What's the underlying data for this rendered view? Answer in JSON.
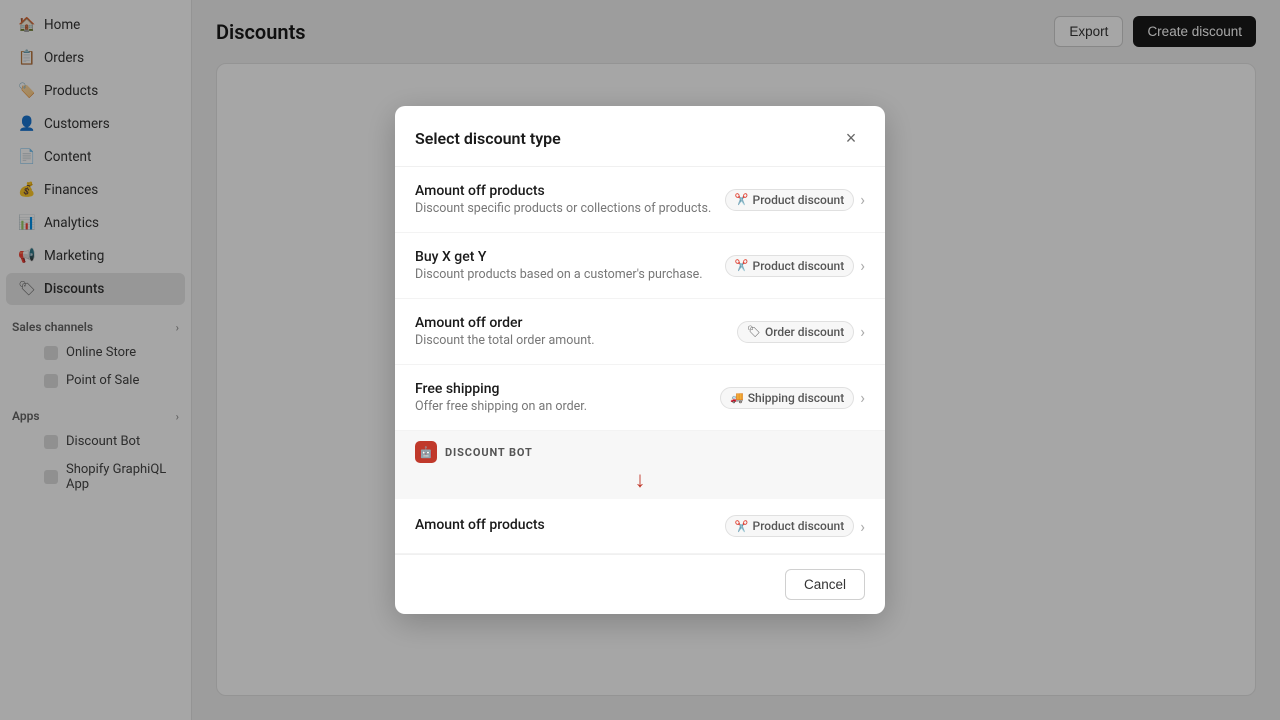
{
  "sidebar": {
    "items": [
      {
        "id": "home",
        "label": "Home",
        "icon": "🏠",
        "active": false
      },
      {
        "id": "orders",
        "label": "Orders",
        "icon": "📋",
        "active": false
      },
      {
        "id": "products",
        "label": "Products",
        "icon": "🏷️",
        "active": false
      },
      {
        "id": "customers",
        "label": "Customers",
        "icon": "👤",
        "active": false
      },
      {
        "id": "content",
        "label": "Content",
        "icon": "📄",
        "active": false
      },
      {
        "id": "finances",
        "label": "Finances",
        "icon": "💰",
        "active": false
      },
      {
        "id": "analytics",
        "label": "Analytics",
        "icon": "📊",
        "active": false
      },
      {
        "id": "marketing",
        "label": "Marketing",
        "icon": "📢",
        "active": false
      },
      {
        "id": "discounts",
        "label": "Discounts",
        "icon": "🏷",
        "active": true
      }
    ],
    "sales_channels_label": "Sales channels",
    "sales_channels": [
      {
        "id": "online-store",
        "label": "Online Store"
      },
      {
        "id": "point-of-sale",
        "label": "Point of Sale"
      }
    ],
    "apps_label": "Apps",
    "apps": [
      {
        "id": "discount-bot",
        "label": "Discount Bot"
      },
      {
        "id": "shopify-graphiql",
        "label": "Shopify GraphiQL App"
      }
    ]
  },
  "header": {
    "title": "Discounts",
    "export_label": "Export",
    "create_discount_label": "Create discount"
  },
  "modal": {
    "title": "Select discount type",
    "close_label": "×",
    "options": [
      {
        "id": "amount-off-products",
        "title": "Amount off products",
        "desc": "Discount specific products or collections of products.",
        "badge": "Product discount",
        "badge_icon": "✂️"
      },
      {
        "id": "buy-x-get-y",
        "title": "Buy X get Y",
        "desc": "Discount products based on a customer's purchase.",
        "badge": "Product discount",
        "badge_icon": "✂️"
      },
      {
        "id": "amount-off-order",
        "title": "Amount off order",
        "desc": "Discount the total order amount.",
        "badge": "Order discount",
        "badge_icon": "🏷"
      },
      {
        "id": "free-shipping",
        "title": "Free shipping",
        "desc": "Offer free shipping on an order.",
        "badge": "Shipping discount",
        "badge_icon": "🚚"
      }
    ],
    "discount_bot_label": "DISCOUNT BOT",
    "bot_option": {
      "id": "bot-amount-off-products",
      "title": "Amount off products",
      "badge": "Product discount",
      "badge_icon": "✂️"
    },
    "cancel_label": "Cancel"
  }
}
